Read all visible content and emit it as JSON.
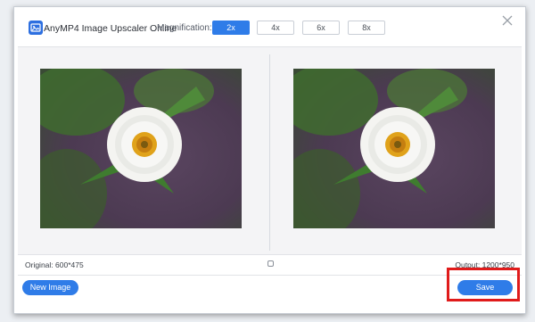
{
  "app": {
    "title": "AnyMP4 Image Upscaler Online",
    "logo_icon": "image-upscaler-logo-icon"
  },
  "magnification": {
    "label": "Magnification:",
    "options": [
      "2x",
      "4x",
      "6x",
      "8x"
    ],
    "selected": "2x"
  },
  "close_icon": "close-icon",
  "images": {
    "original_alt": "white zinnia flower",
    "output_alt": "white zinnia flower upscaled"
  },
  "footer": {
    "original": "Original: 600*475",
    "output": "Output: 1200*950",
    "toggle_icon": "compare-toggle-icon"
  },
  "actions": {
    "new_image": "New Image",
    "save": "Save"
  },
  "colors": {
    "accent": "#2f7ce8",
    "highlight": "#e01b1b"
  }
}
